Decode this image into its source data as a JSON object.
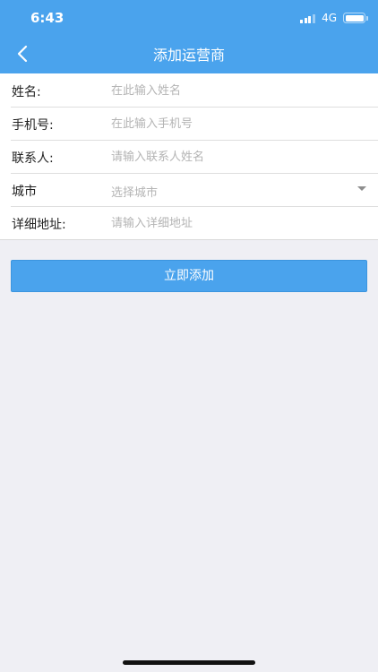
{
  "status_bar": {
    "time": "6:43",
    "network": "4G",
    "signal_bars_active": 3,
    "battery_level": 1.0
  },
  "nav": {
    "back_icon": "chevron-left-icon",
    "title": "添加运营商"
  },
  "form": {
    "name": {
      "label": "姓名:",
      "placeholder": "在此输入姓名",
      "value": ""
    },
    "phone": {
      "label": "手机号:",
      "placeholder": "在此输入手机号",
      "value": ""
    },
    "contact": {
      "label": "联系人:",
      "placeholder": "请输入联系人姓名",
      "value": ""
    },
    "city": {
      "label": "城市",
      "selected_text": "选择城市",
      "dropdown_icon": "caret-down-icon"
    },
    "address": {
      "label": "详细地址:",
      "placeholder": "请输入详细地址",
      "value": ""
    }
  },
  "submit_label": "立即添加",
  "colors": {
    "primary": "#4aa3ed",
    "background": "#efeff4",
    "placeholder": "#b4b4b4",
    "label": "#222222"
  }
}
